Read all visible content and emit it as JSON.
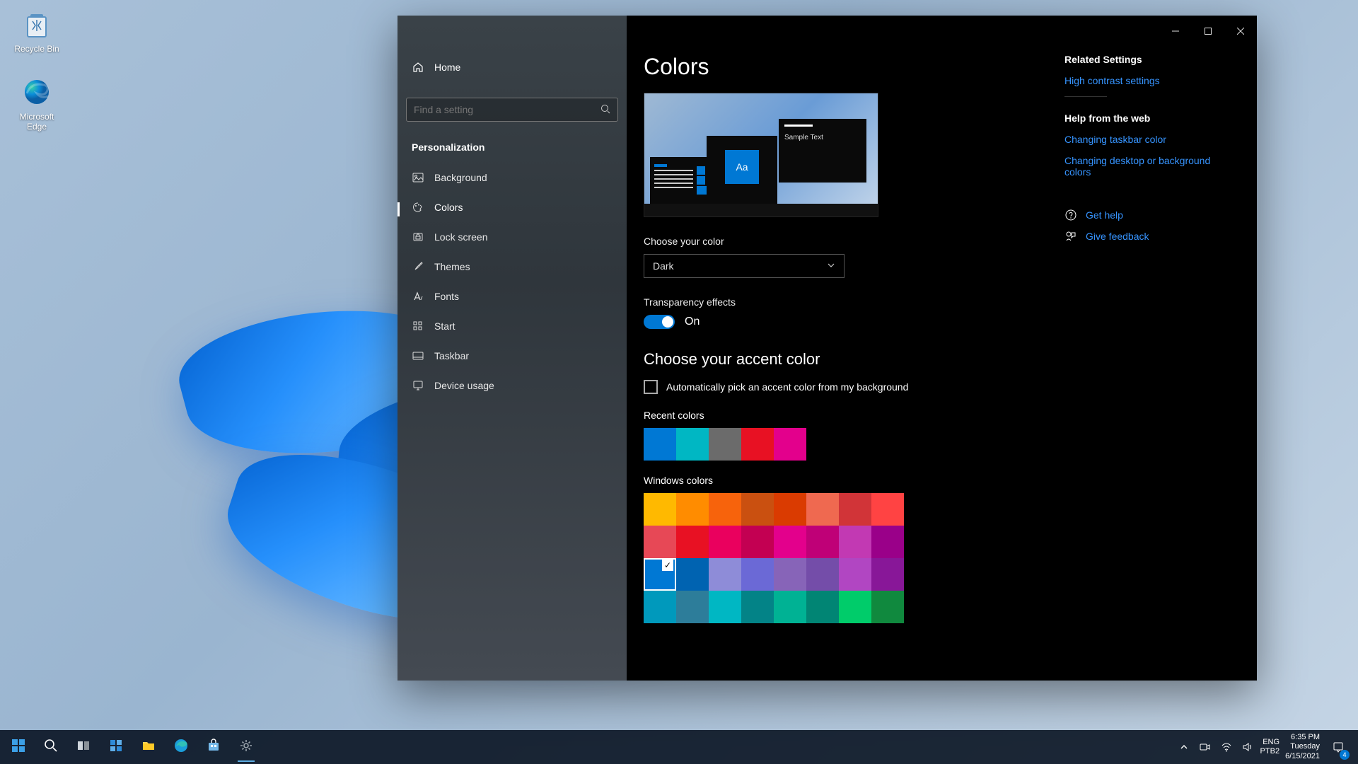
{
  "desktop": {
    "icons": [
      {
        "name": "recycle-bin",
        "label": "Recycle Bin"
      },
      {
        "name": "edge",
        "label": "Microsoft Edge"
      }
    ]
  },
  "window": {
    "title": "Settings",
    "sidebar": {
      "home": "Home",
      "search_placeholder": "Find a setting",
      "section": "Personalization",
      "items": [
        {
          "label": "Background",
          "icon": "image-icon",
          "active": false
        },
        {
          "label": "Colors",
          "icon": "palette-icon",
          "active": true
        },
        {
          "label": "Lock screen",
          "icon": "lock-icon",
          "active": false
        },
        {
          "label": "Themes",
          "icon": "brush-icon",
          "active": false
        },
        {
          "label": "Fonts",
          "icon": "font-icon",
          "active": false
        },
        {
          "label": "Start",
          "icon": "grid-icon",
          "active": false
        },
        {
          "label": "Taskbar",
          "icon": "taskbar-icon",
          "active": false
        },
        {
          "label": "Device usage",
          "icon": "monitor-icon",
          "active": false
        }
      ]
    },
    "content": {
      "heading": "Colors",
      "preview_sample": "Sample Text",
      "preview_aa": "Aa",
      "choose_color_label": "Choose your color",
      "choose_color_value": "Dark",
      "transparency_label": "Transparency effects",
      "transparency_value": "On",
      "accent_heading": "Choose your accent color",
      "auto_pick_label": "Automatically pick an accent color from my background",
      "auto_pick_checked": false,
      "recent_label": "Recent colors",
      "recent_colors": [
        "#0078d4",
        "#00b7c3",
        "#6b6b6b",
        "#e81123",
        "#e3008c"
      ],
      "windows_label": "Windows colors",
      "windows_colors": [
        "#ffb900",
        "#ff8c00",
        "#f7630c",
        "#ca5010",
        "#da3b01",
        "#ef6950",
        "#d13438",
        "#ff4343",
        "#e74856",
        "#e81123",
        "#ea005e",
        "#c30052",
        "#e3008c",
        "#bf0077",
        "#c239b3",
        "#9a0089",
        "#0078d4",
        "#0063b1",
        "#8e8cd8",
        "#6b69d6",
        "#8764b8",
        "#744da9",
        "#b146c2",
        "#881798",
        "#0099bc",
        "#2d7d9a",
        "#00b7c3",
        "#038387",
        "#00b294",
        "#018574",
        "#00cc6a",
        "#10893e"
      ],
      "selected_color_index": 16
    },
    "related": {
      "heading": "Related Settings",
      "links": [
        "High contrast settings"
      ],
      "help_heading": "Help from the web",
      "help_links": [
        "Changing taskbar color",
        "Changing desktop or background colors"
      ],
      "get_help": "Get help",
      "give_feedback": "Give feedback"
    }
  },
  "taskbar": {
    "apps": [
      {
        "name": "start",
        "icon": "start-icon"
      },
      {
        "name": "search",
        "icon": "search-icon"
      },
      {
        "name": "task-view",
        "icon": "taskview-icon"
      },
      {
        "name": "widgets",
        "icon": "widgets-icon"
      },
      {
        "name": "explorer",
        "icon": "folder-icon"
      },
      {
        "name": "edge",
        "icon": "edge-icon"
      },
      {
        "name": "store",
        "icon": "store-icon"
      },
      {
        "name": "settings",
        "icon": "gear-icon",
        "active": true
      }
    ],
    "tray": {
      "chevron": "⌃",
      "lang1": "ENG",
      "lang2": "PTB2",
      "time": "6:35 PM",
      "day": "Tuesday",
      "date": "6/15/2021",
      "notifications": "4"
    }
  }
}
